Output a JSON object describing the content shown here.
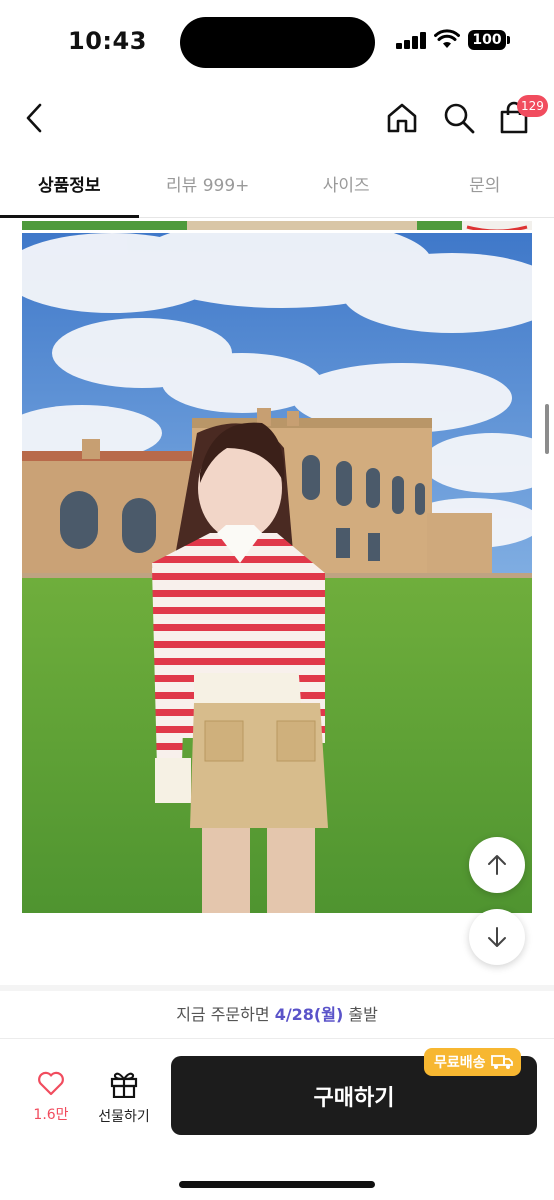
{
  "status_bar": {
    "time": "10:43",
    "battery": "100"
  },
  "header": {
    "icons": [
      "back-icon",
      "home-icon",
      "search-icon",
      "cart-icon"
    ],
    "cart_count": "129"
  },
  "tabs": [
    {
      "label": "상품정보",
      "active": true
    },
    {
      "label": "리뷰 999+",
      "active": false
    },
    {
      "label": "사이즈",
      "active": false
    },
    {
      "label": "문의",
      "active": false
    }
  ],
  "photo": {
    "subject": "model in red striped cardigan and beige mini skirt",
    "icons": [
      "scroll-up-icon",
      "scroll-down-icon"
    ]
  },
  "delivery": {
    "prefix": "지금 주문하면 ",
    "date": "4/28(월)",
    "suffix": " 출발"
  },
  "bottom_bar": {
    "like_count": "1.6만",
    "gift_label": "선물하기",
    "buy_label": "구매하기",
    "shipping_badge": "무료배송"
  },
  "colors": {
    "accent_red": "#f14c5e",
    "highlight_purple": "#5a53c9",
    "buy_button": "#1c1c1c",
    "badge_yellow": "#f7b731"
  }
}
